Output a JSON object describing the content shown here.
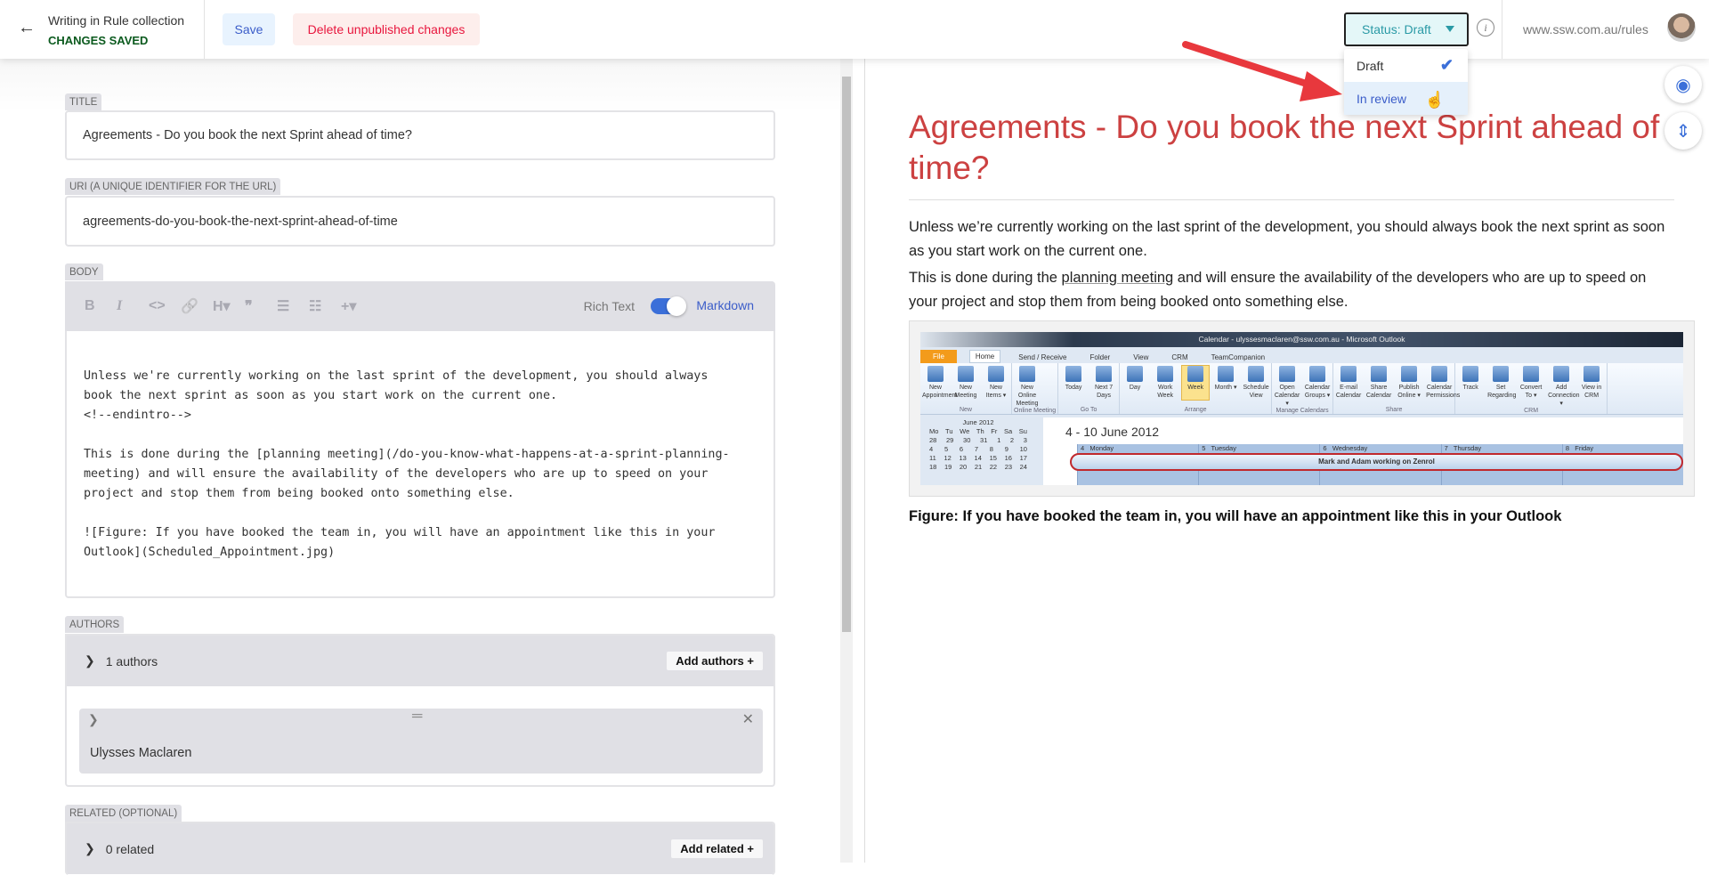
{
  "header": {
    "back_icon": "arrow-left-icon",
    "collection": "Writing in Rule collection",
    "save_state": "CHANGES SAVED",
    "save_label": "Save",
    "delete_label": "Delete unpublished changes",
    "status_label": "Status: Draft",
    "url": "www.ssw.com.au/rules"
  },
  "status_menu": {
    "options": [
      {
        "label": "Draft",
        "selected": true
      },
      {
        "label": "In review",
        "hovered": true
      }
    ]
  },
  "form": {
    "title_label": "TITLE",
    "title_value": "Agreements - Do you book the next Sprint ahead of time?",
    "uri_label": "URI (A UNIQUE IDENTIFIER FOR THE URL)",
    "uri_value": "agreements-do-you-book-the-next-sprint-ahead-of-time",
    "body_label": "BODY",
    "toolbar": {
      "bold": "B",
      "italic": "I",
      "code": "<>",
      "link": "🔗",
      "heading": "H▾",
      "quote": "❞",
      "bullets": "☰",
      "numbers": "☷",
      "more": "+▾",
      "rich_text": "Rich Text",
      "markdown": "Markdown",
      "markdown_on": true
    },
    "body_value": "Unless we're currently working on the last sprint of the development, you should always\nbook the next sprint as soon as you start work on the current one.\n<!--endintro-->\n\nThis is done during the [planning meeting](/do-you-know-what-happens-at-a-sprint-planning-\nmeeting) and will ensure the availability of the developers who are up to speed on your\nproject and stop them from being booked onto something else.\n\n![Figure: If you have booked the team in, you will have an appointment like this in your\nOutlook](Scheduled_Appointment.jpg)",
    "authors_label": "AUTHORS",
    "authors_count": "1 authors",
    "add_authors": "Add authors +",
    "author_name": "Ulysses Maclaren",
    "related_label": "RELATED (OPTIONAL)",
    "related_count": "0 related",
    "add_related": "Add related +"
  },
  "preview": {
    "title": "Agreements - Do you book the next Sprint ahead of time?",
    "para1": "Unless we’re currently working on the last sprint of the development, you should always book the next sprint as soon as you start work on the current one.",
    "para2_pre": "This is done during the ",
    "para2_link": "planning meeting",
    "para2_post": " and will ensure the availability of the developers who are up to speed on your project and stop them from being booked onto something else.",
    "caption": "Figure: If you have booked the team in, you will have an appointment like this in your Outlook",
    "title_color": "#cc4141"
  },
  "outlook": {
    "window_title": "Calendar - ulyssesmaclaren@ssw.com.au - Microsoft Outlook",
    "tabs": [
      "File",
      "Home",
      "Send / Receive",
      "Folder",
      "View",
      "CRM",
      "TeamCompanion"
    ],
    "groups": [
      {
        "name": "New",
        "items": [
          "New Appointment",
          "New Meeting",
          "New Items ▾"
        ]
      },
      {
        "name": "Online Meeting",
        "items": [
          "New Online Meeting"
        ]
      },
      {
        "name": "Go To",
        "items": [
          "Today",
          "Next 7 Days"
        ]
      },
      {
        "name": "Arrange",
        "items": [
          "Day",
          "Work Week",
          "Week",
          "Month ▾",
          "Schedule View"
        ]
      },
      {
        "name": "Manage Calendars",
        "items": [
          "Open Calendar ▾",
          "Calendar Groups ▾"
        ]
      },
      {
        "name": "Share",
        "items": [
          "E-mail Calendar",
          "Share Calendar",
          "Publish Online ▾",
          "Calendar Permissions"
        ]
      },
      {
        "name": "CRM",
        "items": [
          "Track",
          "Set Regarding",
          "Convert To ▾",
          "Add Connection ▾",
          "View in CRM"
        ]
      }
    ],
    "mini_month": "June 2012",
    "mini_days": [
      "Mo",
      "Tu",
      "We",
      "Th",
      "Fr",
      "Sa",
      "Su"
    ],
    "mini_rows": [
      [
        "28",
        "29",
        "30",
        "31",
        "1",
        "2",
        "3"
      ],
      [
        "4",
        "5",
        "6",
        "7",
        "8",
        "9",
        "10"
      ],
      [
        "11",
        "12",
        "13",
        "14",
        "15",
        "16",
        "17"
      ],
      [
        "18",
        "19",
        "20",
        "21",
        "22",
        "23",
        "24"
      ]
    ],
    "week": "4 - 10 June 2012",
    "day_headers": [
      "4   Monday",
      "5   Tuesday",
      "6   Wednesday",
      "7   Thursday",
      "8   Friday"
    ],
    "appointment": "Mark and Adam working on Zenrol"
  }
}
